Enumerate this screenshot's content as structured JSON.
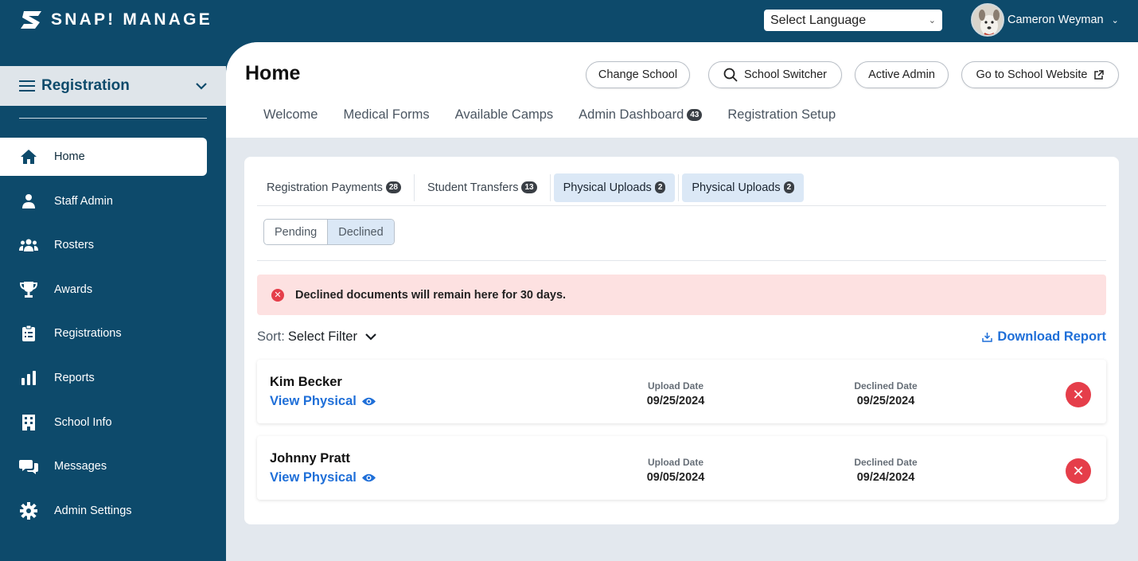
{
  "app": {
    "brand": "SNAP! MANAGE"
  },
  "topbar": {
    "language_select": "Select Language",
    "user_name": "Cameron Weyman"
  },
  "sidebar": {
    "section": "Registration",
    "items": [
      {
        "label": "Home",
        "icon": "home-icon",
        "active": true
      },
      {
        "label": "Staff Admin",
        "icon": "person-icon"
      },
      {
        "label": "Rosters",
        "icon": "group-icon"
      },
      {
        "label": "Awards",
        "icon": "trophy-icon"
      },
      {
        "label": "Registrations",
        "icon": "clipboard-icon"
      },
      {
        "label": "Reports",
        "icon": "bar-chart-icon"
      },
      {
        "label": "School Info",
        "icon": "building-icon"
      },
      {
        "label": "Messages",
        "icon": "chat-icon"
      },
      {
        "label": "Admin Settings",
        "icon": "gear-icon"
      }
    ]
  },
  "header": {
    "title": "Home",
    "buttons": {
      "change_school": "Change School",
      "school_switcher": "School Switcher",
      "active_admin": "Active Admin",
      "school_website": "Go to School Website"
    },
    "tabs": [
      {
        "label": "Welcome"
      },
      {
        "label": "Medical Forms"
      },
      {
        "label": "Available Camps"
      },
      {
        "label": "Admin Dashboard",
        "badge": "43"
      },
      {
        "label": "Registration Setup"
      }
    ]
  },
  "card": {
    "subtabs": [
      {
        "label": "Registration Payments",
        "badge": "28"
      },
      {
        "label": "Student Transfers",
        "badge": "13"
      },
      {
        "label": "Physical Uploads",
        "badge": "2"
      },
      {
        "label": "Physical Uploads",
        "badge": "2"
      }
    ],
    "segments": {
      "pending": "Pending",
      "declined": "Declined"
    },
    "alert": "Declined documents will remain here for 30 days.",
    "sort_label": "Sort:",
    "sort_value": "Select Filter",
    "download": "Download Report",
    "rows": [
      {
        "name": "Kim Becker",
        "link": "View Physical",
        "upload_label": "Upload Date",
        "upload_date": "09/25/2024",
        "declined_label": "Declined Date",
        "declined_date": "09/25/2024"
      },
      {
        "name": "Johnny Pratt",
        "link": "View Physical",
        "upload_label": "Upload Date",
        "upload_date": "09/05/2024",
        "declined_label": "Declined Date",
        "declined_date": "09/24/2024"
      }
    ]
  },
  "colors": {
    "brand": "#0d4a6b",
    "link": "#1f6fd8",
    "danger": "#e53e4a",
    "alert_bg": "#fde1e1"
  }
}
